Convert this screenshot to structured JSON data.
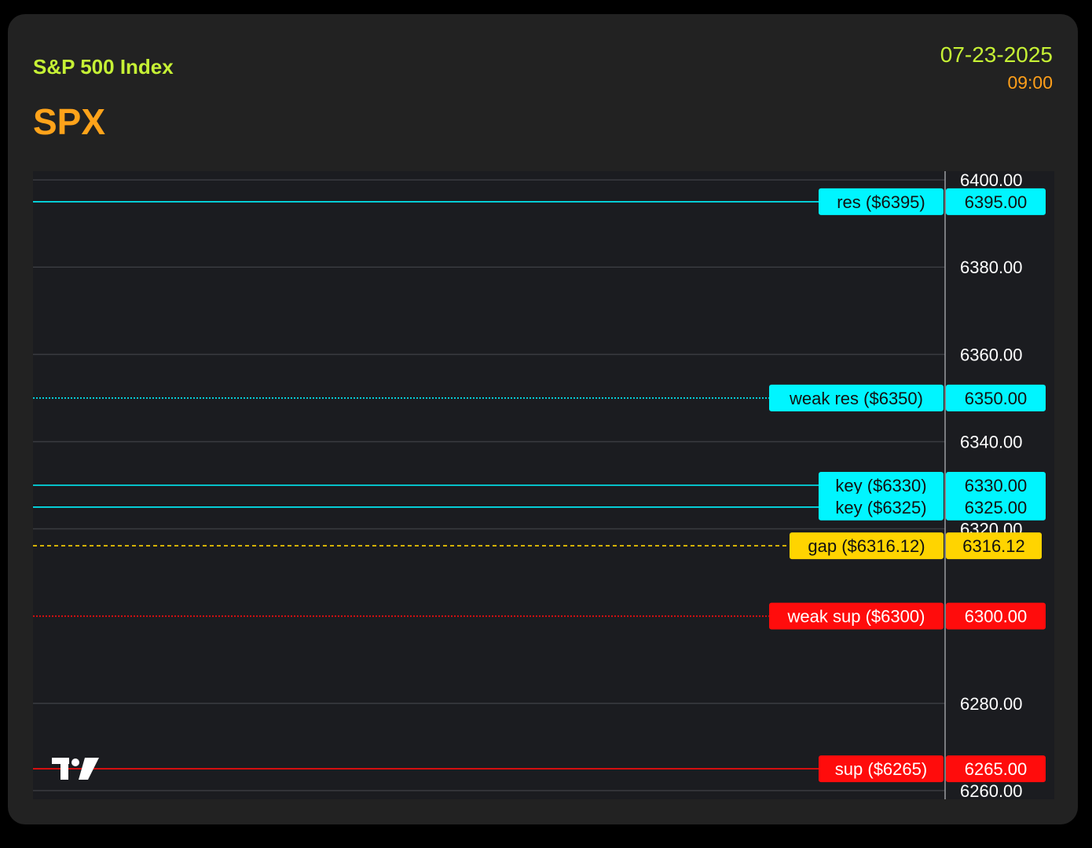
{
  "header": {
    "index_name": "S&P 500 Index",
    "ticker": "SPX",
    "date": "07-23-2025",
    "time": "09:00"
  },
  "colors": {
    "background": "#000000",
    "card": "#222222",
    "plot": "#1b1c20",
    "grid": "#3a3b40",
    "index_name": "#c6f135",
    "ticker": "#ffa31a",
    "date": "#c6f135",
    "time": "#ff9f1a",
    "resistance": "#00f5ff",
    "gap": "#ffd400",
    "support": "#ff0c0c",
    "axis_text": "#ffffff"
  },
  "logo": {
    "icon": "tradingview-logo-icon"
  },
  "chart_data": {
    "type": "line",
    "ylim": [
      6258,
      6402
    ],
    "y_ticks": [
      {
        "value": 6400,
        "label": "6400.00"
      },
      {
        "value": 6380,
        "label": "6380.00"
      },
      {
        "value": 6360,
        "label": "6360.00"
      },
      {
        "value": 6340,
        "label": "6340.00"
      },
      {
        "value": 6320,
        "label": "6320.00"
      },
      {
        "value": 6280,
        "label": "6280.00"
      },
      {
        "value": 6260,
        "label": "6260.00"
      }
    ],
    "levels": [
      {
        "value": 6395,
        "label": "res ($6395)",
        "price_label": "6395.00",
        "color": "#00f5ff",
        "style": "solid"
      },
      {
        "value": 6350,
        "label": "weak res ($6350)",
        "price_label": "6350.00",
        "color": "#00f5ff",
        "style": "dotted"
      },
      {
        "value": 6330,
        "label": "key ($6330)",
        "price_label": "6330.00",
        "color": "#00f5ff",
        "style": "solid"
      },
      {
        "value": 6325,
        "label": "key ($6325)",
        "price_label": "6325.00",
        "color": "#00f5ff",
        "style": "solid"
      },
      {
        "value": 6316.12,
        "label": "gap ($6316.12)",
        "price_label": "6316.12",
        "color": "#ffd400",
        "style": "dashed"
      },
      {
        "value": 6300,
        "label": "weak sup ($6300)",
        "price_label": "6300.00",
        "color": "#ff0c0c",
        "style": "dotted"
      },
      {
        "value": 6265,
        "label": "sup ($6265)",
        "price_label": "6265.00",
        "color": "#ff0c0c",
        "style": "solid"
      }
    ]
  }
}
